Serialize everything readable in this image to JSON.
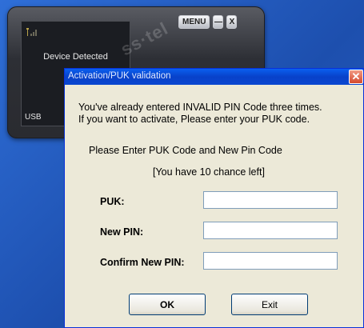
{
  "widget": {
    "status": "Device Detected",
    "connection": "USB",
    "watermark": "ss·tel",
    "menu_label": "MENU",
    "minimize_glyph": "—",
    "close_glyph": "X",
    "icons": [
      "signal-strength-icon",
      "minimize-icon",
      "close-icon"
    ]
  },
  "dialog": {
    "title": "Activation/PUK validation",
    "close_glyph": "✕",
    "message_line1": "You've already entered INVALID PIN Code three times.",
    "message_line2": "If you want to activate, Please enter your PUK code.",
    "instruction": "Please Enter PUK Code and New Pin Code",
    "chances": "[You have 10 chance left]",
    "fields": {
      "puk_label": "PUK:",
      "new_pin_label": "New PIN:",
      "confirm_pin_label": "Confirm New PIN:",
      "puk_value": "",
      "new_pin_value": "",
      "confirm_pin_value": ""
    },
    "ok_label": "OK",
    "exit_label": "Exit"
  },
  "colors": {
    "desktop": "#2b5fbd",
    "titlebar": "#0a5ff0",
    "dialog_bg": "#ece9d8"
  }
}
